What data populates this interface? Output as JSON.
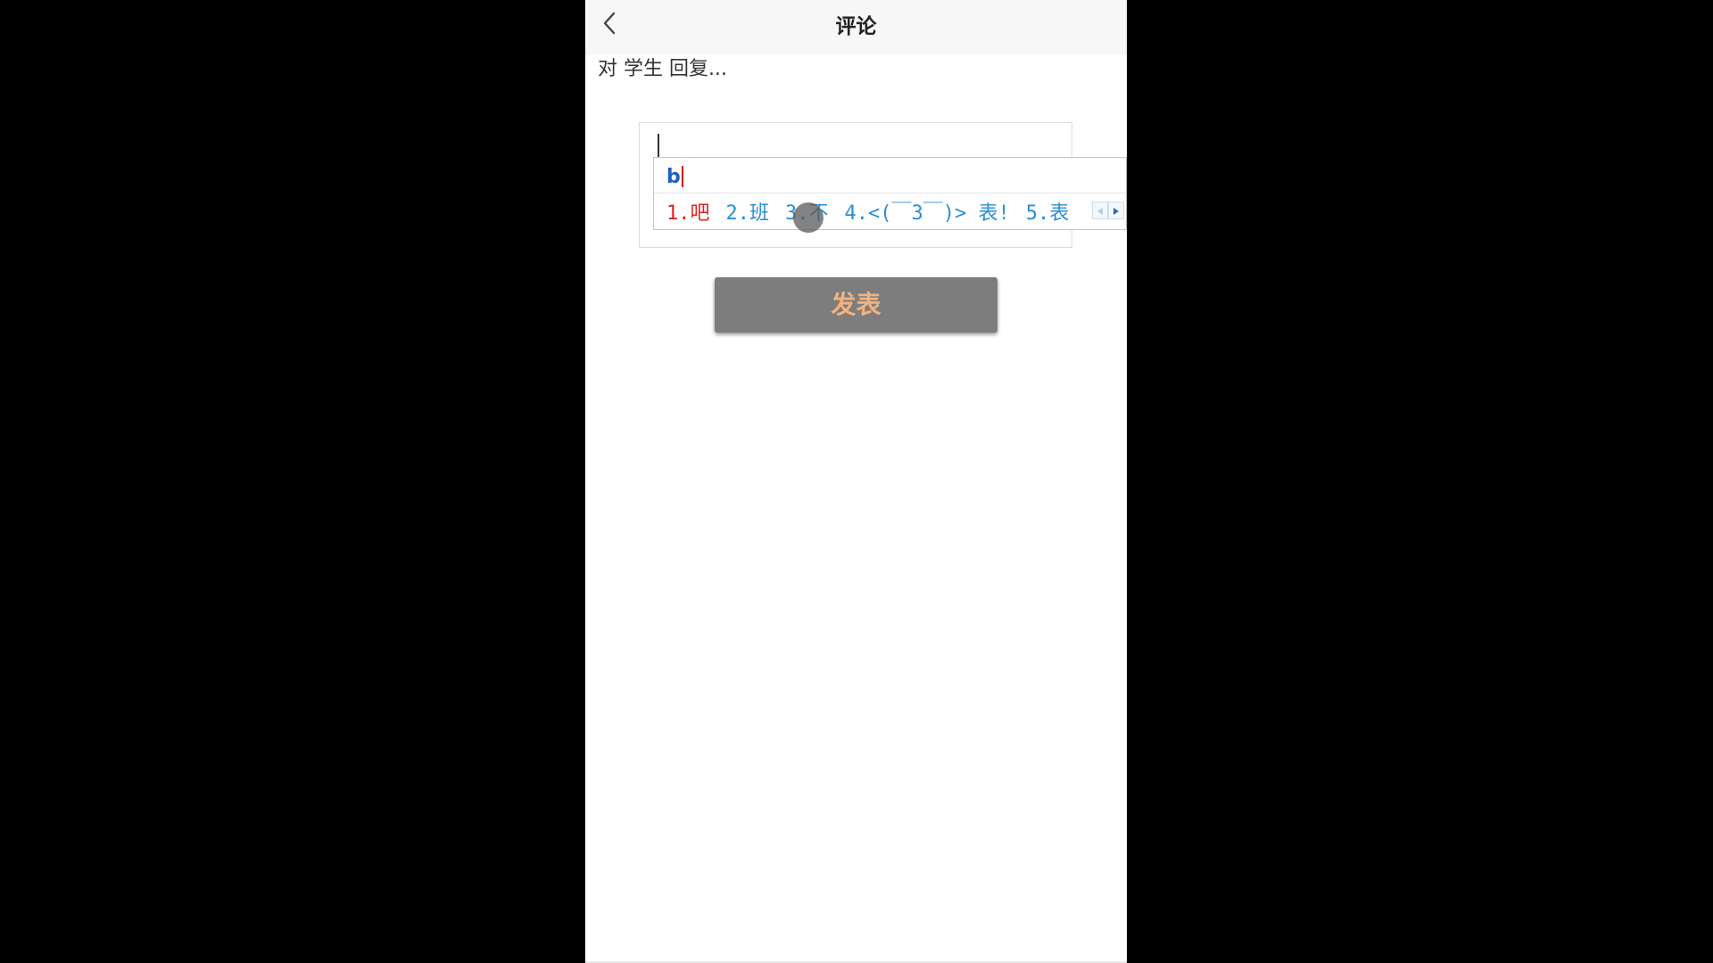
{
  "header": {
    "title": "评论",
    "back_icon": "chevron-left-icon"
  },
  "reply_hint": "对 学生 回复...",
  "comment_input": {
    "value": ""
  },
  "ime": {
    "composition": "b",
    "candidates": [
      {
        "label": "1.吧",
        "active": true
      },
      {
        "label": "2.班",
        "active": false
      },
      {
        "label": "3.不",
        "active": false
      },
      {
        "label": "4.<(￣3￣)> 表!",
        "active": false
      },
      {
        "label": "5.表",
        "active": false
      }
    ],
    "prev_icon": "triangle-left-icon",
    "next_icon": "triangle-right-icon"
  },
  "publish_button": {
    "label": "发表"
  },
  "colors": {
    "background": "#000000",
    "header_bg": "#f7f7f7",
    "button_bg": "#7d7d7d",
    "button_text": "#f3b27f",
    "candidate_active": "#e02020",
    "candidate_normal": "#2a8fd6"
  }
}
